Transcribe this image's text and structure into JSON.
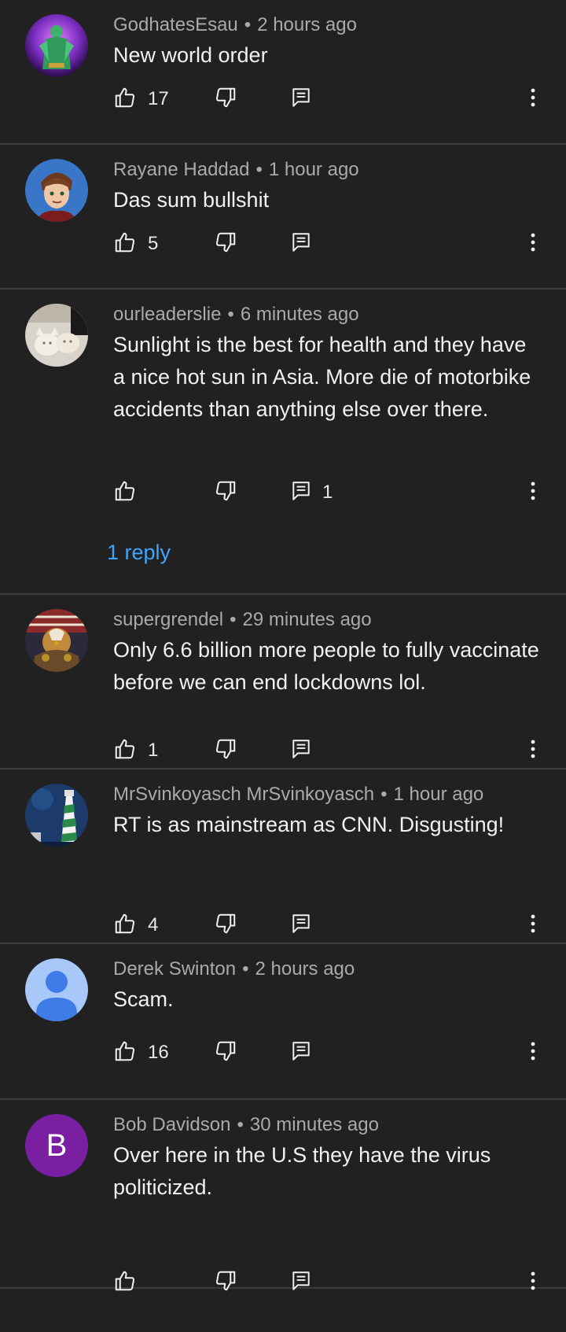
{
  "comments": [
    {
      "author": "GodhatesEsau",
      "time": "2 hours ago",
      "text": "New world order",
      "likes": "17",
      "replies": "",
      "reply_link": "",
      "avatar": "green-figure",
      "height": 0
    },
    {
      "author": "Rayane Haddad",
      "time": "1 hour ago",
      "text": "Das sum bullshit",
      "likes": "5",
      "replies": "",
      "reply_link": "",
      "avatar": "cartoon-boy"
    },
    {
      "author": "ourleaderslie",
      "time": "6 minutes ago",
      "text": "Sunlight is the best for health and they have a nice hot sun in Asia. More die of motorbike accidents than anything else over there.",
      "likes": "",
      "replies": "1",
      "reply_link": "1 reply",
      "avatar": "white-cats"
    },
    {
      "author": "supergrendel",
      "time": "29 minutes ago",
      "text": "Only 6.6 billion more people to fully vaccinate before we can end lockdowns lol.",
      "likes": "1",
      "replies": "",
      "reply_link": "",
      "avatar": "eagle-warrior"
    },
    {
      "author": "MrSvinkoyasch MrSvinkoyasch",
      "time": "1 hour ago",
      "text": "RT is as mainstream as CNN. Disgusting!",
      "likes": "4",
      "replies": "",
      "reply_link": "",
      "avatar": "lighthouse"
    },
    {
      "author": "Derek Swinton",
      "time": "2 hours ago",
      "text": "Scam.",
      "likes": "16",
      "replies": "",
      "reply_link": "",
      "avatar": "default-person"
    },
    {
      "author": "Bob Davidson",
      "time": "30 minutes ago",
      "text": "Over here in the U.S they have the virus politicized.",
      "likes": "",
      "replies": "",
      "reply_link": "",
      "avatar": "letter",
      "avatar_letter": "B"
    }
  ],
  "colors": {
    "background": "#212121",
    "divider": "#3b3b3b",
    "meta": "#aaaaaa",
    "link": "#3ea6ff",
    "letter_avatar": "#7b1fa2"
  },
  "icons": {
    "like": "thumbs-up-icon",
    "dislike": "thumbs-down-icon",
    "reply": "comment-icon",
    "more": "more-vertical-icon"
  }
}
